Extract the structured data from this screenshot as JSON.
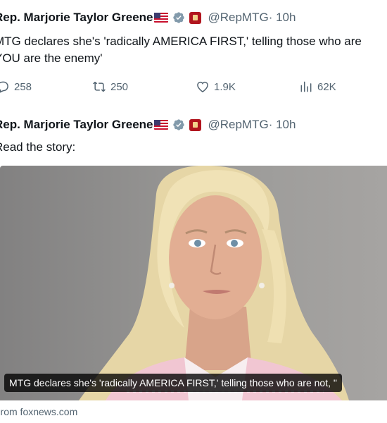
{
  "colors": {
    "text": "#0f1419",
    "secondary": "#536471",
    "verified": "#829aab",
    "gov_badge": "#b1151e"
  },
  "tweets": [
    {
      "author_name": "Rep. Marjorie Taylor Greene",
      "handle": "@RepMTG",
      "separator_time": " · 10h",
      "text_line1": "MTG declares she's 'radically AMERICA FIRST,' telling those who are",
      "text_line2": "YOU are the enemy'",
      "icons": [
        "us-flag-icon",
        "verified-badge-icon",
        "government-badge-icon"
      ],
      "metrics": {
        "replies": "258",
        "reposts": "250",
        "likes": "1.9K",
        "views": "62K"
      }
    },
    {
      "author_name": "Rep. Marjorie Taylor Greene",
      "handle": "@RepMTG",
      "separator_time": " · 10h",
      "text_line1": "Read the story:",
      "icons": [
        "us-flag-icon",
        "verified-badge-icon",
        "government-badge-icon"
      ],
      "link_card": {
        "caption": "MTG declares she's 'radically AMERICA FIRST,' telling those who are not, \"",
        "source": "From foxnews.com"
      }
    }
  ]
}
